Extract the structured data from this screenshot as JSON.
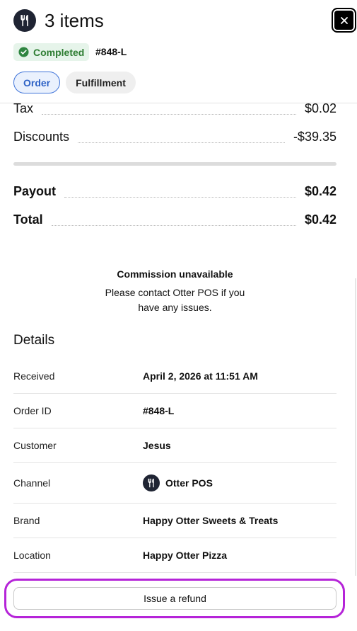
{
  "header": {
    "title": "3 items",
    "brand_icon": "fork-knife-icon",
    "close_icon": "close-icon",
    "status": {
      "label": "Completed",
      "icon": "check-circle-icon",
      "color": "#2e7d32"
    },
    "order_number": "#848-L",
    "tabs": [
      {
        "label": "Order",
        "active": true
      },
      {
        "label": "Fulfillment",
        "active": false
      }
    ]
  },
  "summary": {
    "lines": [
      {
        "label": "Tax",
        "amount": "$0.02"
      },
      {
        "label": "Discounts",
        "amount": "-$39.35"
      }
    ],
    "payout": {
      "label": "Payout",
      "amount": "$0.42"
    },
    "total": {
      "label": "Total",
      "amount": "$0.42"
    }
  },
  "commission": {
    "title": "Commission unavailable",
    "text": "Please contact Otter POS if you have any issues."
  },
  "details": {
    "title": "Details",
    "rows": [
      {
        "label": "Received",
        "value": "April 2, 2026 at 11:51 AM"
      },
      {
        "label": "Order ID",
        "value": "#848-L"
      },
      {
        "label": "Customer",
        "value": "Jesus"
      },
      {
        "label": "Channel",
        "value": "Otter POS",
        "icon": "fork-knife-icon"
      },
      {
        "label": "Brand",
        "value": "Happy Otter Sweets & Treats"
      },
      {
        "label": "Location",
        "value": "Happy Otter Pizza"
      }
    ]
  },
  "footer": {
    "refund_label": "Issue a refund",
    "highlight_color": "#b524d8"
  },
  "colors": {
    "accent": "#3e73d9",
    "brand_dark": "#1f2433",
    "success_bg": "#e6f4ea"
  }
}
